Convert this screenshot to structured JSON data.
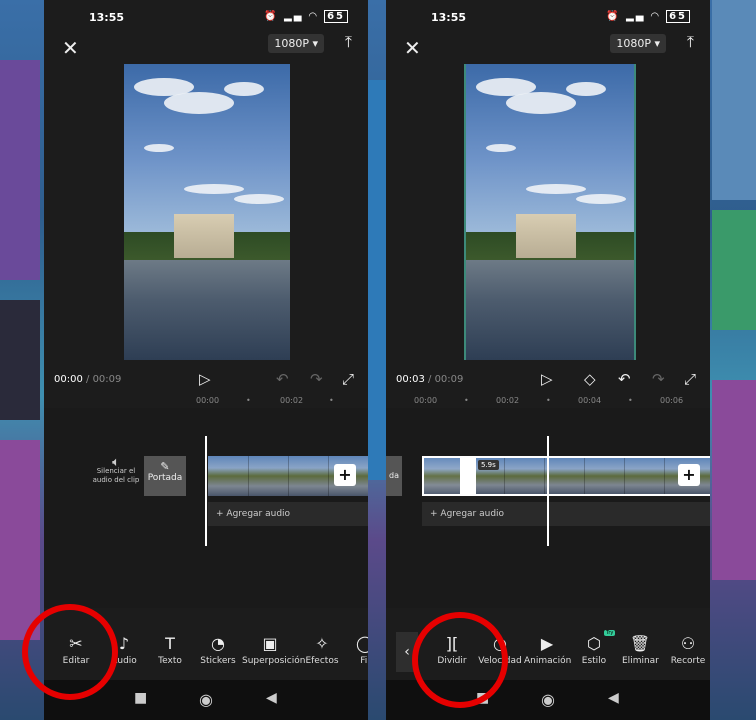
{
  "left": {
    "status_time": "13:55",
    "status_battery": "65",
    "resolution": "1080P",
    "timecode_current": "00:00",
    "timecode_total": "/ 00:09",
    "ruler": [
      "00:00",
      "00:02"
    ],
    "mute_label": "Silenciar el audio del clip",
    "cover_label": "Portada",
    "add_audio": "Agregar audio",
    "tools": [
      "Editar",
      "Audio",
      "Texto",
      "Stickers",
      "Superposición",
      "Efectos",
      "Fil"
    ]
  },
  "right": {
    "status_time": "13:55",
    "status_battery": "65",
    "resolution": "1080P",
    "timecode_current": "00:03",
    "timecode_total": "/ 00:09",
    "ruler": [
      "00:00",
      "00:02",
      "00:04",
      "00:06"
    ],
    "clip_end_label": "da",
    "duration_badge": "5.9s",
    "add_audio": "Agregar audio",
    "new_badge": "Try",
    "tools": [
      "Dividir",
      "Velocidad",
      "Animación",
      "Estilo",
      "Eliminar",
      "Recorte"
    ]
  },
  "icons": {
    "close": "close-icon",
    "export": "upload-icon",
    "play": "play-icon",
    "undo": "undo-icon",
    "redo": "redo-icon",
    "fullscreen": "fullscreen-icon"
  },
  "colors": {
    "highlight_circle": "#e60000",
    "bg": "#1c1c1c"
  }
}
